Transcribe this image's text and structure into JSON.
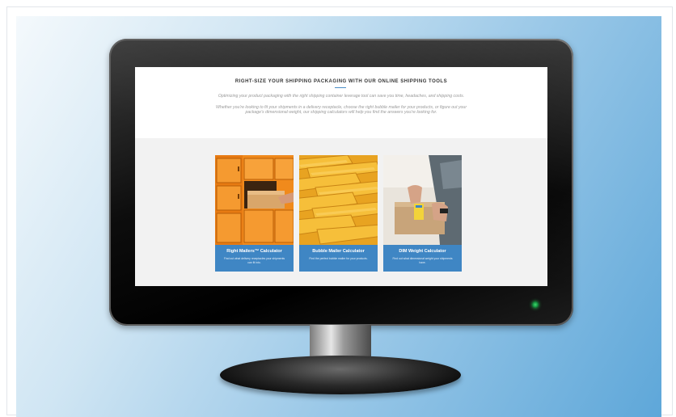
{
  "screen": {
    "heading": "RIGHT-SIZE YOUR SHIPPING PACKAGING WITH OUR ONLINE SHIPPING TOOLS",
    "intro": "Optimizing your product packaging with the right shipping container leverage tool can save you time, headaches, and shipping costs.",
    "body": "Whether you're looking to fit your shipments in a delivery receptacle, choose the right bubble mailer for your products, or figure out your package's dimensional weight, our shipping calculators will help you find the answers you're looking for."
  },
  "cards": [
    {
      "title": "Right Mailers™ Calculator",
      "description": "Find out what delivery receptacles your shipments can fit into."
    },
    {
      "title": "Bubble Mailer Calculator",
      "description": "Find the perfect bubble mailer for your products."
    },
    {
      "title": "DIM Weight Calculator",
      "description": "Find out what dimensional weight your shipments have."
    }
  ],
  "colors": {
    "accent": "#3f86c4",
    "backdrop_start": "#f4f9fc",
    "backdrop_end": "#5ea7d9",
    "bezel": "#0d0d0d",
    "power_led": "#3ddc6a"
  }
}
